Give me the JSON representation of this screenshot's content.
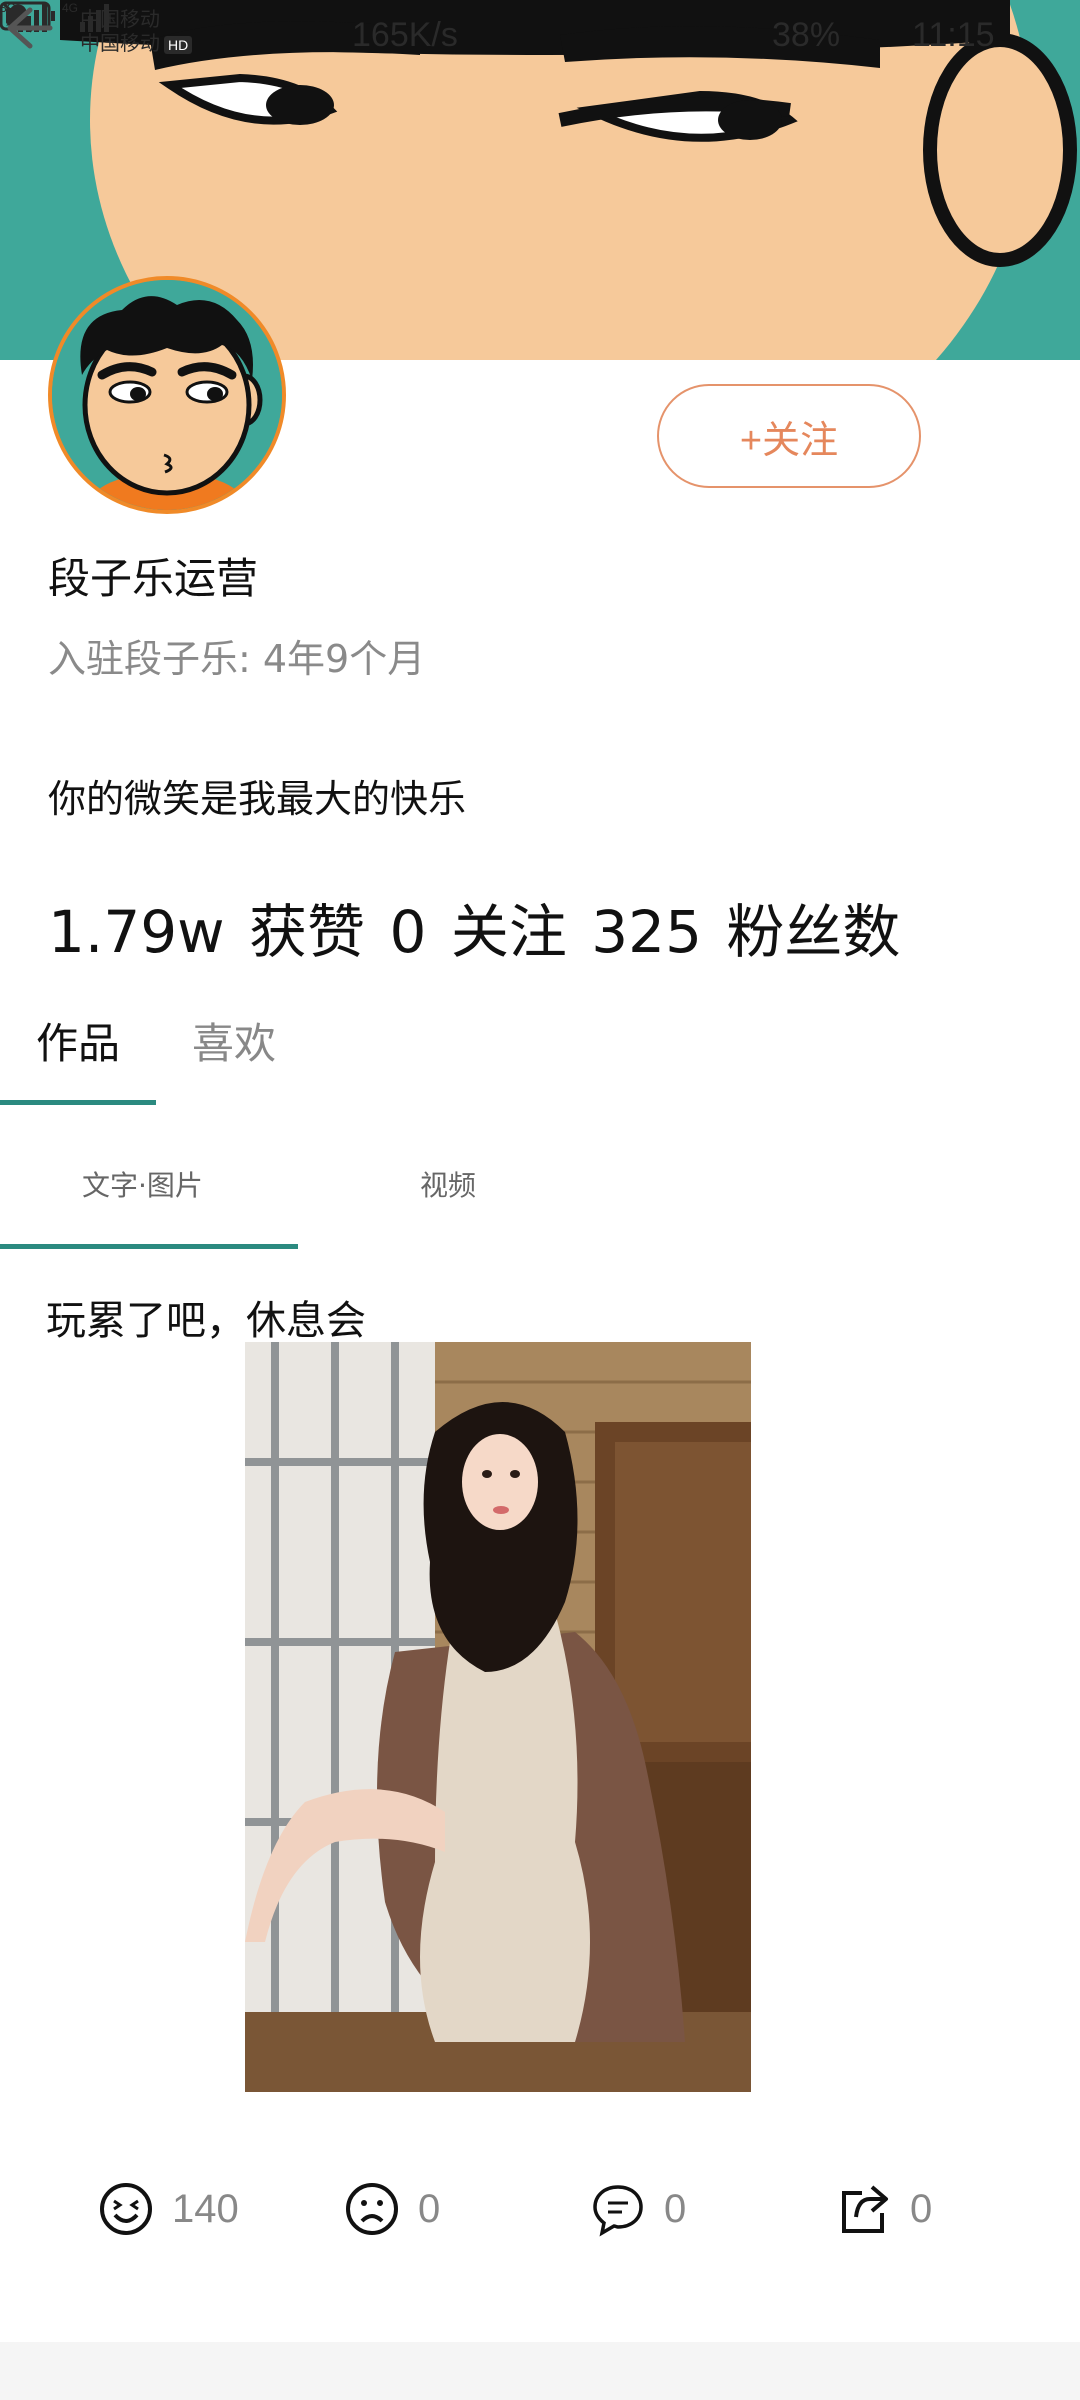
{
  "status_bar": {
    "carrier_line1": "中国移动",
    "carrier_line2": "中国移动",
    "hd_badge": "HD",
    "signal_1": "3G",
    "signal_2": "4G",
    "net_speed": "165K/s",
    "battery": "38%",
    "time": "11:15"
  },
  "header": {
    "back_icon": "arrow-left"
  },
  "profile": {
    "follow_label": "+关注",
    "username": "段子乐运营",
    "join_info": "入驻段子乐: 4年9个月",
    "bio": "你的微笑是我最大的快乐",
    "stats": [
      {
        "value": "1.79w",
        "label": "获赞"
      },
      {
        "value": "0",
        "label": "关注"
      },
      {
        "value": "325",
        "label": "粉丝数"
      }
    ]
  },
  "tabs": {
    "main": [
      {
        "label": "作品",
        "active": true
      },
      {
        "label": "喜欢",
        "active": false
      }
    ],
    "sub": [
      {
        "label": "文字·图片",
        "active": true
      },
      {
        "label": "视频",
        "active": false
      }
    ]
  },
  "post": {
    "title": "玩累了吧，休息会",
    "actions": [
      {
        "icon": "laugh-icon",
        "count": "140"
      },
      {
        "icon": "sad-icon",
        "count": "0"
      },
      {
        "icon": "comment-icon",
        "count": "0"
      },
      {
        "icon": "share-icon",
        "count": "0"
      }
    ]
  },
  "colors": {
    "accent_teal": "#2b8a80",
    "follow_orange": "#e5875c",
    "banner_bg": "#3fa89a",
    "face": "#f6c99a"
  }
}
